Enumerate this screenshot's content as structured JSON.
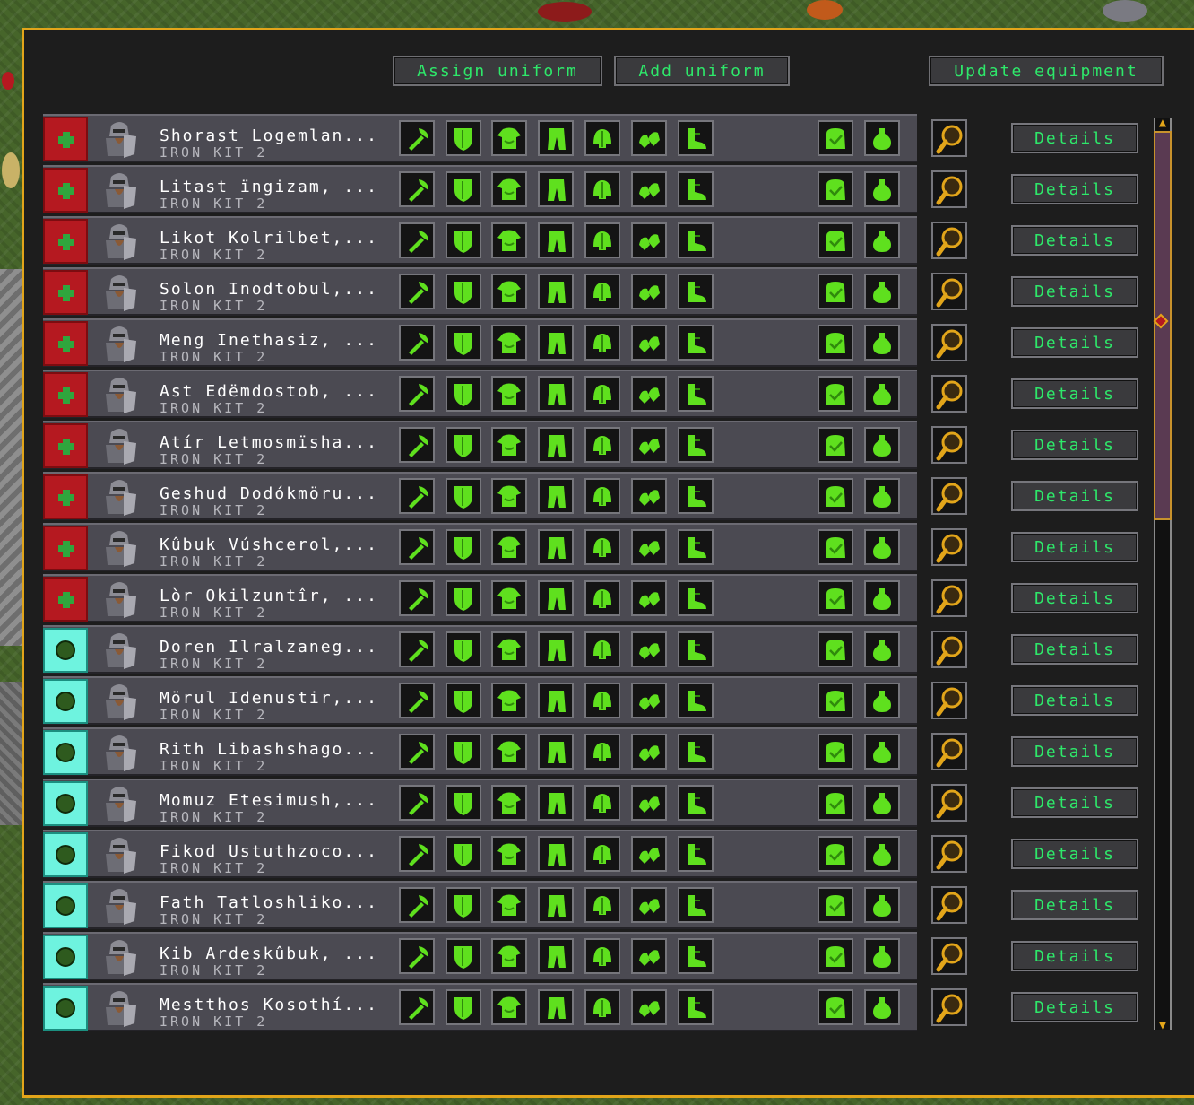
{
  "toolbar": {
    "assign_uniform": "Assign uniform",
    "add_uniform": "Add uniform",
    "update_equipment": "Update equipment"
  },
  "colors": {
    "frame": "#e2a51a",
    "button_text": "#2ee86a",
    "icon_green": "#5fe01e",
    "status_red": "#b51920",
    "status_cyan": "#6ef3df"
  },
  "equipment_slots": [
    "axe-icon",
    "shield-icon",
    "armor-icon",
    "leggings-icon",
    "helm-icon",
    "gloves-icon",
    "boots-icon",
    "backpack-icon",
    "flask-icon"
  ],
  "details_label": "Details",
  "squad": [
    {
      "name": "Shorast Logemlan...",
      "kit": "IRON KIT 2",
      "status": "red"
    },
    {
      "name": "Litast ïngizam, ...",
      "kit": "IRON KIT 2",
      "status": "red"
    },
    {
      "name": "Likot Kolrilbet,...",
      "kit": "IRON KIT 2",
      "status": "red"
    },
    {
      "name": "Solon Inodtobul,...",
      "kit": "IRON KIT 2",
      "status": "red"
    },
    {
      "name": "Meng Inethasiz, ...",
      "kit": "IRON KIT 2",
      "status": "red"
    },
    {
      "name": "Ast Edëmdostob, ...",
      "kit": "IRON KIT 2",
      "status": "red"
    },
    {
      "name": "Atír Letmosmïsha...",
      "kit": "IRON KIT 2",
      "status": "red"
    },
    {
      "name": "Geshud Dodókmöru...",
      "kit": "IRON KIT 2",
      "status": "red"
    },
    {
      "name": "Kûbuk Vúshcerol,...",
      "kit": "IRON KIT 2",
      "status": "red"
    },
    {
      "name": "Lòr Okilzuntîr, ...",
      "kit": "IRON KIT 2",
      "status": "red"
    },
    {
      "name": "Doren Ilralzaneg...",
      "kit": "IRON KIT 2",
      "status": "cyan"
    },
    {
      "name": "Mörul Idenustir,...",
      "kit": "IRON KIT 2",
      "status": "cyan"
    },
    {
      "name": "Rith Libashshago...",
      "kit": "IRON KIT 2",
      "status": "cyan"
    },
    {
      "name": "Momuz Etesimush,...",
      "kit": "IRON KIT 2",
      "status": "cyan"
    },
    {
      "name": "Fikod Ustuthzoco...",
      "kit": "IRON KIT 2",
      "status": "cyan"
    },
    {
      "name": "Fath Tatloshliko...",
      "kit": "IRON KIT 2",
      "status": "cyan"
    },
    {
      "name": "Kib Ardeskûbuk, ...",
      "kit": "IRON KIT 2",
      "status": "cyan"
    },
    {
      "name": "Mestthos Kosothí...",
      "kit": "IRON KIT 2",
      "status": "cyan"
    }
  ],
  "scrollbar": {
    "position": 0.0,
    "visible_fraction": 0.43
  }
}
